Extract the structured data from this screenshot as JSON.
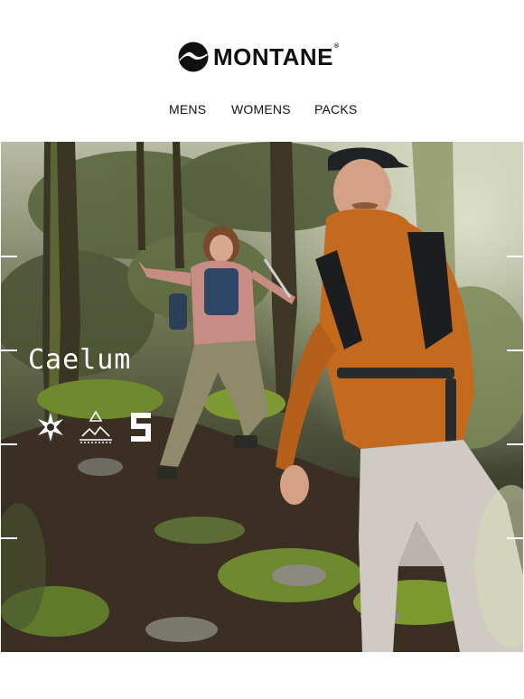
{
  "brand": {
    "name": "MONTANE",
    "reg": "®",
    "logo_icon": "mountain-disc-icon"
  },
  "nav": {
    "items": [
      {
        "label": "MENS"
      },
      {
        "label": "WOMENS"
      },
      {
        "label": "PACKS"
      }
    ]
  },
  "hero": {
    "title": "Caelum",
    "badges": [
      {
        "icon": "snowflake-star-icon"
      },
      {
        "icon": "recycle-mountain-icon"
      },
      {
        "icon": "fabric-logo-icon"
      }
    ],
    "colors": {
      "forest_dark": "#2d3023",
      "moss": "#6f8a2e",
      "jacket_orange": "#c46a1f",
      "jacket_pink": "#c78d84",
      "pants_light": "#cfcac4",
      "pants_khaki": "#8f8a6c"
    }
  }
}
